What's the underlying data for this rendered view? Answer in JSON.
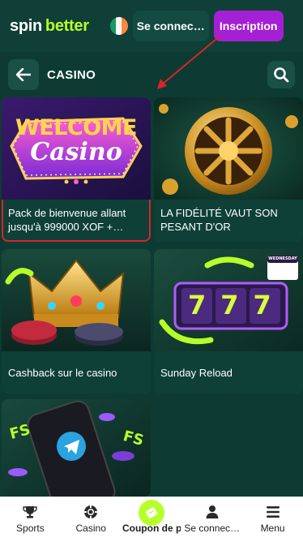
{
  "header": {
    "logo_part1": "spin",
    "logo_part2": "better",
    "flag_colors": [
      "#169b62",
      "#ffffff",
      "#ff883e"
    ],
    "login_label": "Se connec…",
    "signup_label": "Inscription"
  },
  "section": {
    "title": "CASINO"
  },
  "cards": [
    {
      "caption": "Pack de bienvenue allant jusqu'à 999000 XOF +…",
      "image_text_1": "WELCOME",
      "image_text_2": "Casino"
    },
    {
      "caption": "LA FIDÉLITÉ VAUT SON PESANT D'OR"
    },
    {
      "caption": "Cashback sur le casino"
    },
    {
      "caption": "Sunday Reload",
      "image_text_1": "777",
      "image_text_2": "WEDNESDAY"
    },
    {
      "caption": "",
      "image_text_1": "FS",
      "image_text_2": "FS"
    }
  ],
  "bottom_nav": [
    {
      "label": "Sports",
      "icon": "trophy-icon"
    },
    {
      "label": "Casino",
      "icon": "casino-chip-icon"
    },
    {
      "label": "Coupon de pari",
      "icon": "coupon-ticket-icon"
    },
    {
      "label": "Se connec…",
      "icon": "user-icon"
    },
    {
      "label": "Menu",
      "icon": "menu-icon"
    }
  ],
  "colors": {
    "background": "#0d3b33",
    "accent_green": "#b7ff2a",
    "signup_purple": "#a51fd4",
    "highlight_red": "#d9252a"
  }
}
